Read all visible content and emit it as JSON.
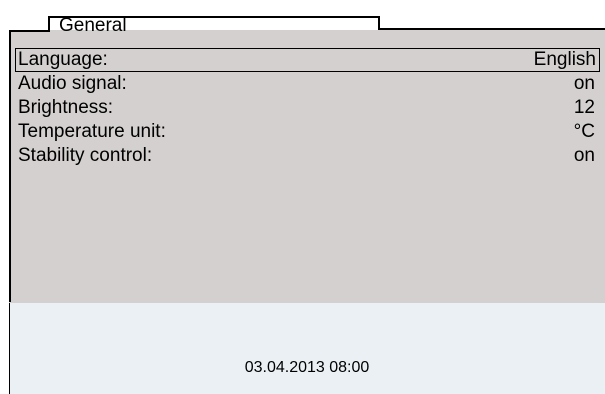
{
  "tab": {
    "label": "General"
  },
  "settings": {
    "items": [
      {
        "label": "Language:",
        "value": "English"
      },
      {
        "label": "Audio signal:",
        "value": "on"
      },
      {
        "label": "Brightness:",
        "value": "12"
      },
      {
        "label": "Temperature unit:",
        "value": "°C"
      },
      {
        "label": "Stability control:",
        "value": "on"
      }
    ],
    "selected_index": 0
  },
  "status": {
    "datetime": "03.04.2013 08:00"
  },
  "colors": {
    "panel": "#d3d0cf",
    "status_panel": "#eaf0f4",
    "frame": "#000000"
  }
}
